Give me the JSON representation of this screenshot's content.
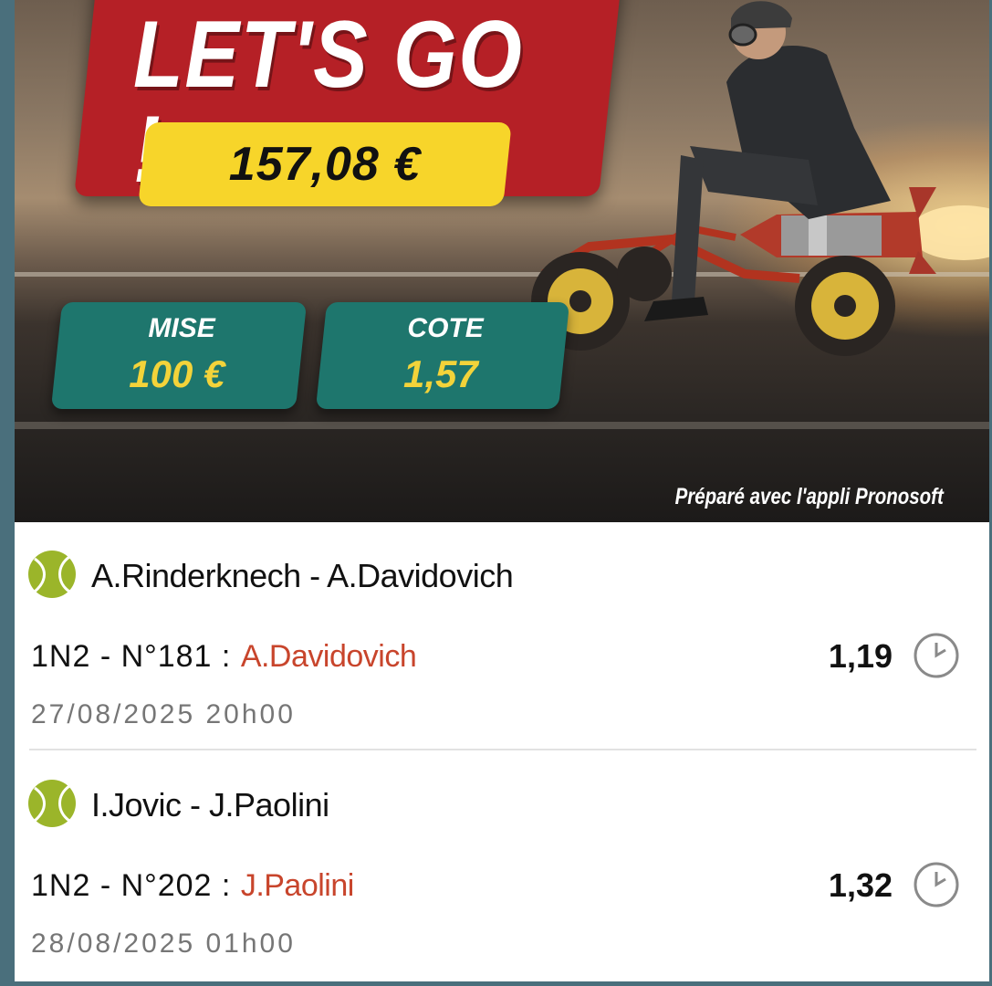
{
  "banner": {
    "headline": "LET'S GO !",
    "amount": "157,08 €",
    "stake": {
      "label": "MISE",
      "value": "100 €"
    },
    "odds": {
      "label": "COTE",
      "value": "1,57"
    },
    "credit": "Préparé avec l'appli Pronosoft"
  },
  "bets": [
    {
      "sport_icon": "tennis-ball-icon",
      "match": "A.Rinderknech - A.Davidovich",
      "market": "1N2 - N°181 :",
      "selection": "A.Davidovich",
      "odds": "1,19",
      "status_icon": "clock-icon",
      "date": "27/08/2025 20h00"
    },
    {
      "sport_icon": "tennis-ball-icon",
      "match": "I.Jovic - J.Paolini",
      "market": "1N2 - N°202 :",
      "selection": "J.Paolini",
      "odds": "1,32",
      "status_icon": "clock-icon",
      "date": "28/08/2025 01h00"
    }
  ],
  "colors": {
    "banner_red": "#b52026",
    "amount_yellow": "#f7d52a",
    "stat_teal": "#1e766d",
    "stat_value_yellow": "#f3d33a",
    "selection_orange": "#c8452c",
    "tennis_green": "#9bb52a"
  }
}
